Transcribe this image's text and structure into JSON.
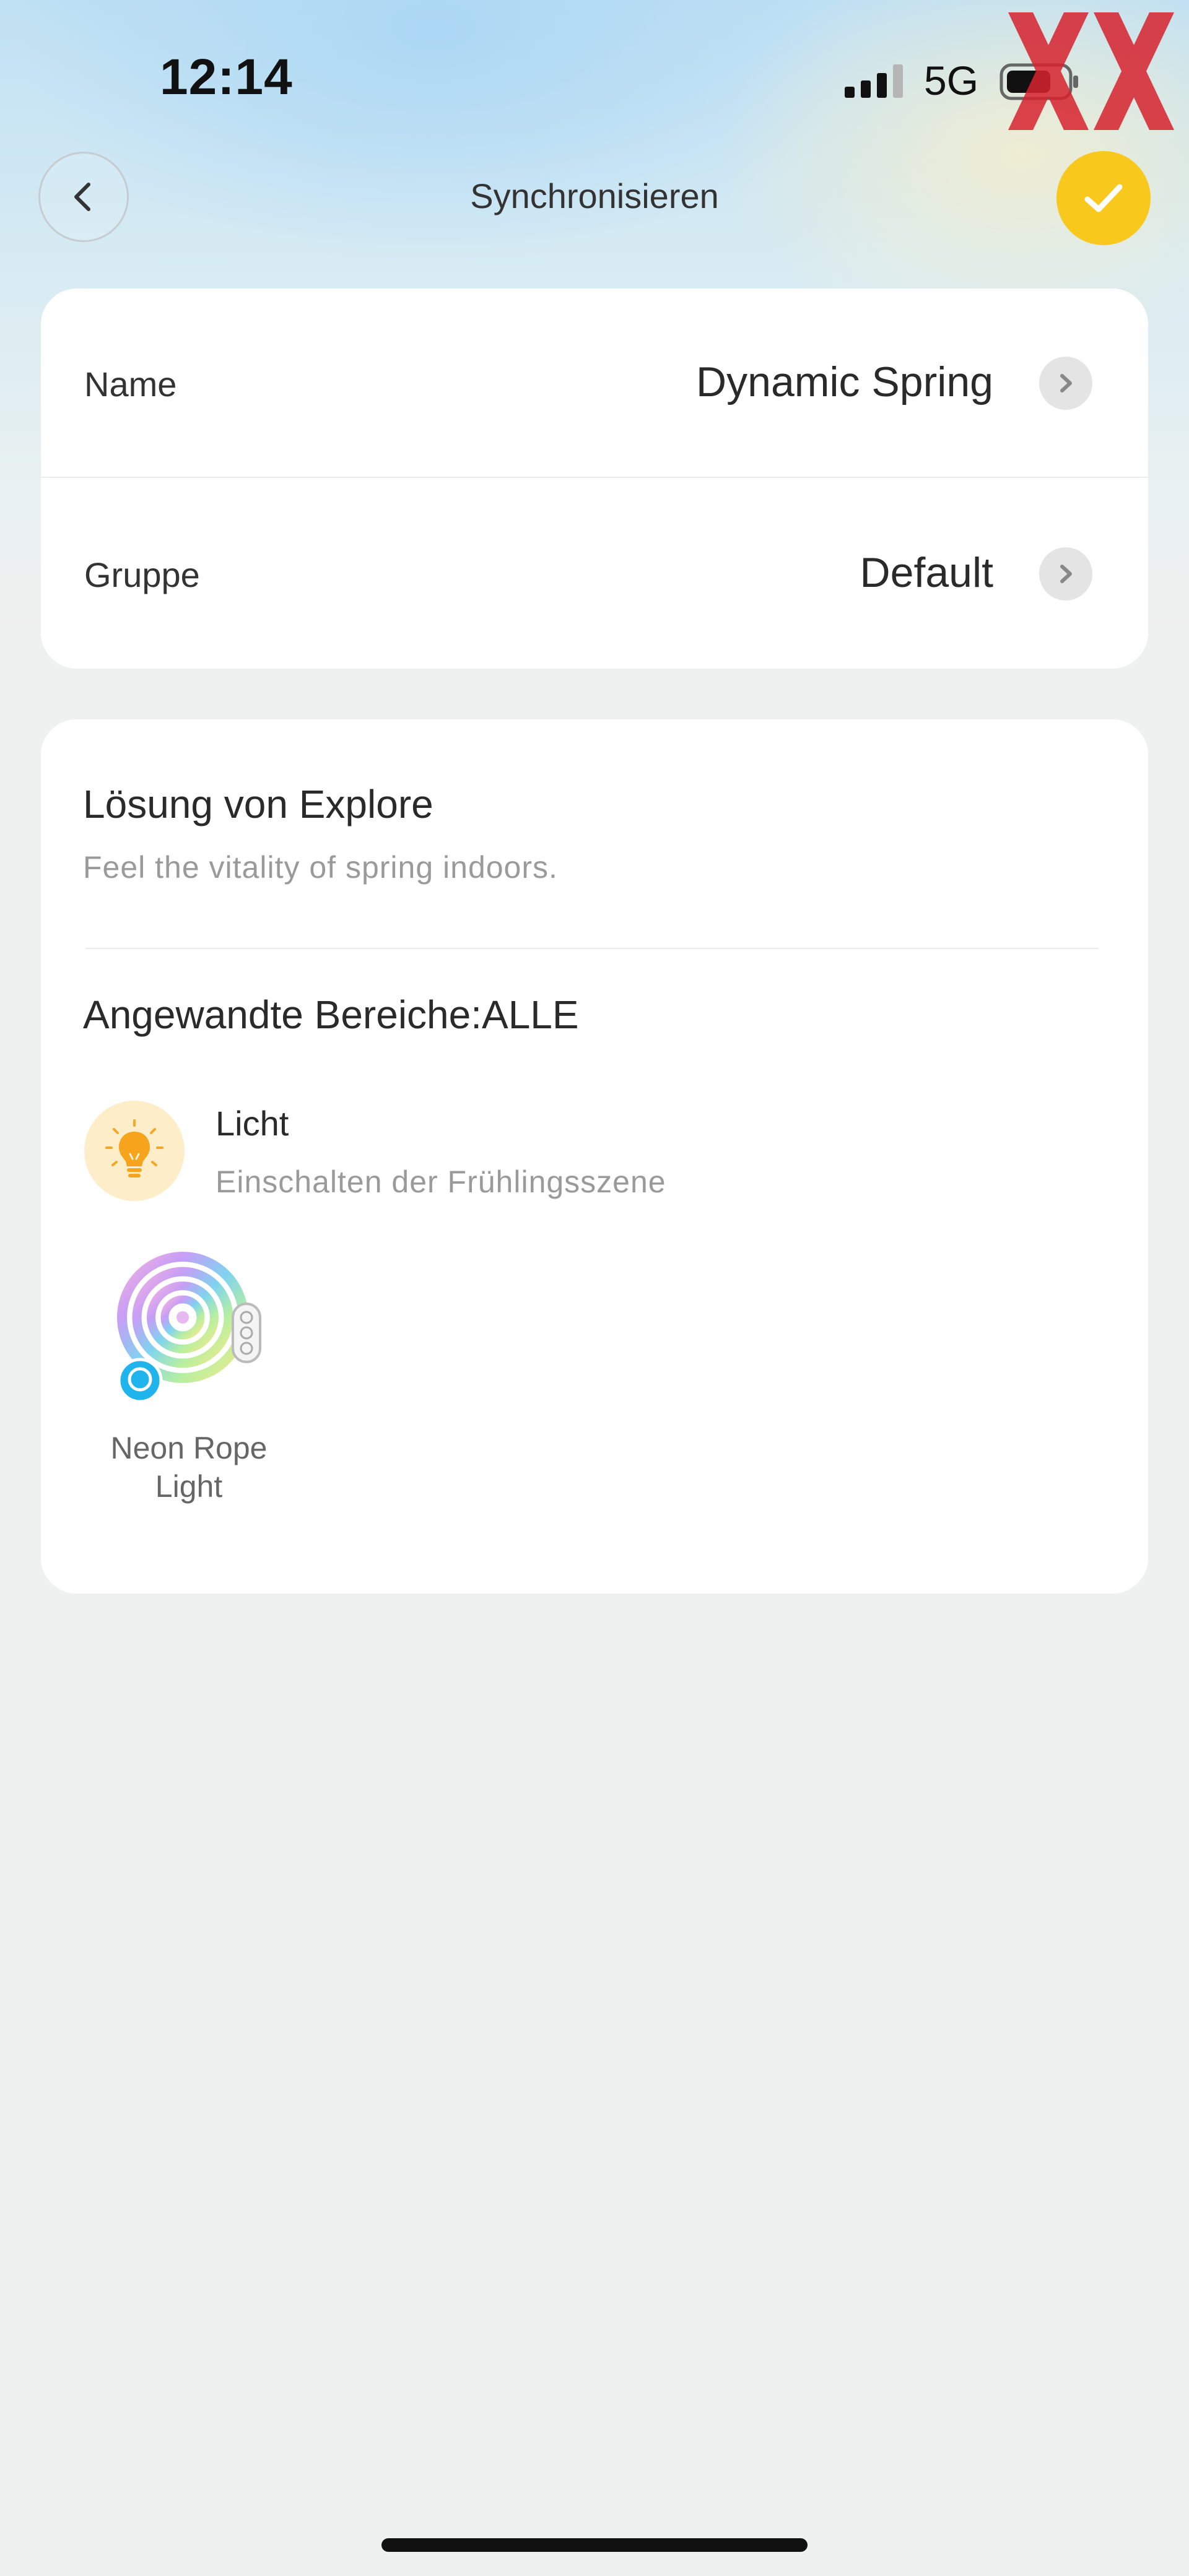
{
  "status_bar": {
    "time": "12:14",
    "network": "5G",
    "signal_icon": "cellular-signal-icon",
    "battery_icon": "battery-icon"
  },
  "header": {
    "title": "Synchronisieren",
    "back_icon": "chevron-left-icon",
    "confirm_icon": "checkmark-icon",
    "accent_color": "#f8c81d"
  },
  "settings": {
    "name_label": "Name",
    "name_value": "Dynamic Spring",
    "group_label": "Gruppe",
    "group_value": "Default",
    "chevron_icon": "chevron-right-icon"
  },
  "solution": {
    "title": "Lösung von Explore",
    "description": "Feel the vitality of spring indoors.",
    "areas_heading": "Angewandte Bereiche:ALLE",
    "category": {
      "icon": "lightbulb-icon",
      "label": "Licht",
      "description": "Einschalten der Frühlingsszene"
    },
    "device": {
      "icon": "neon-rope-light-icon",
      "name": "Neon Rope Light"
    }
  }
}
